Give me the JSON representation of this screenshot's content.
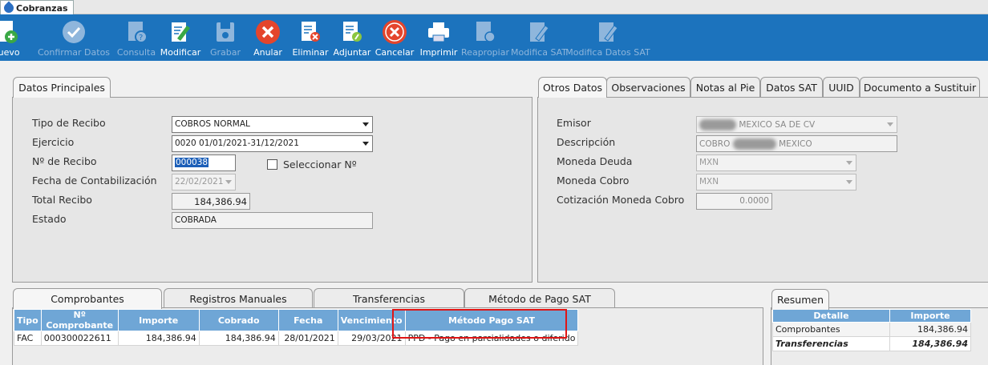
{
  "window": {
    "tab_title": "Cobranzas"
  },
  "toolbar": [
    {
      "label": "Nuevo",
      "icon": "add-doc-icon",
      "enabled": true
    },
    {
      "label": "Confirmar Datos",
      "icon": "check-icon",
      "enabled": false
    },
    {
      "label": "Consulta",
      "icon": "query-doc-icon",
      "enabled": false
    },
    {
      "label": "Modificar",
      "icon": "edit-doc-icon",
      "enabled": true
    },
    {
      "label": "Grabar",
      "icon": "disk-icon",
      "enabled": false
    },
    {
      "label": "Anular",
      "icon": "cancel-x-icon",
      "enabled": true
    },
    {
      "label": "Eliminar",
      "icon": "delete-doc-icon",
      "enabled": true
    },
    {
      "label": "Adjuntar",
      "icon": "attach-doc-icon",
      "enabled": true
    },
    {
      "label": "Cancelar",
      "icon": "cancel-x-icon",
      "enabled": true
    },
    {
      "label": "Imprimir",
      "icon": "printer-icon",
      "enabled": true
    },
    {
      "label": "Reapropiar",
      "icon": "reassign-doc-icon",
      "enabled": false
    },
    {
      "label": "Modifica SAT",
      "icon": "edit-doc-icon",
      "enabled": false
    },
    {
      "label": "Modifica Datos SAT",
      "icon": "edit-doc-icon",
      "enabled": false
    }
  ],
  "main_tab": {
    "label": "Datos Principales"
  },
  "form": {
    "tipo_recibo": {
      "label": "Tipo de Recibo",
      "value": "COBROS NORMAL"
    },
    "ejercicio": {
      "label": "Ejercicio",
      "value": "0020 01/01/2021-31/12/2021"
    },
    "nro_recibo": {
      "label": "Nº de Recibo",
      "value": "000038"
    },
    "seleccionar": {
      "label": "Seleccionar Nº",
      "checked": false
    },
    "fecha_contab": {
      "label": "Fecha de Contabilización",
      "value": "22/02/2021"
    },
    "total": {
      "label": "Total Recibo",
      "value": "184,386.94"
    },
    "estado": {
      "label": "Estado",
      "value": "COBRADA"
    }
  },
  "right_tabs": [
    "Otros Datos",
    "Observaciones",
    "Notas al Pie",
    "Datos SAT",
    "UUID",
    "Documento a Sustituir"
  ],
  "otros": {
    "emisor": {
      "label": "Emisor",
      "value": "MEXICO SA DE CV"
    },
    "descripcion": {
      "label": "Descripción",
      "value_prefix": "COBRO",
      "value_suffix": "MEXICO"
    },
    "moneda_deuda": {
      "label": "Moneda Deuda",
      "value": "MXN"
    },
    "moneda_cobro": {
      "label": "Moneda Cobro",
      "value": "MXN"
    },
    "cotizacion": {
      "label": "Cotización Moneda Cobro",
      "value": "0.0000"
    }
  },
  "bottom_tabs": [
    "Comprobantes",
    "Registros Manuales",
    "Transferencias",
    "Método de Pago SAT"
  ],
  "grid": {
    "headers": [
      "Tipo",
      "Nº Comprobante",
      "Importe",
      "Cobrado",
      "Fecha",
      "Vencimiento",
      "Método Pago SAT"
    ],
    "rows": [
      [
        "FAC",
        "000300022611",
        "184,386.94",
        "184,386.94",
        "28/01/2021",
        "29/03/2021",
        "PPD - Pago en parcialidades o diferido"
      ]
    ]
  },
  "resumen": {
    "tab": "Resumen",
    "headers": [
      "Detalle",
      "Importe"
    ],
    "rows": [
      {
        "detalle": "Comprobantes",
        "importe": "184,386.94"
      },
      {
        "detalle": "Transferencias",
        "importe": "184,386.94"
      }
    ]
  },
  "colors": {
    "toolbar_bg": "#1c73bd",
    "grid_header": "#6fa6d6",
    "highlight": "#e01515"
  }
}
